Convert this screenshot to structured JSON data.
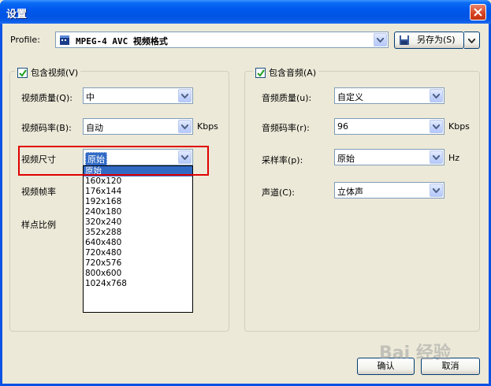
{
  "window": {
    "title": "设置"
  },
  "profile": {
    "label": "Profile:",
    "value": "MPEG-4 AVC 视频格式",
    "save_as_label": "另存为(S)"
  },
  "video": {
    "group_label": "包含视频(V)",
    "quality_label": "视频质量(Q):",
    "quality_value": "中",
    "bitrate_label": "视频码率(B):",
    "bitrate_value": "自动",
    "bitrate_unit": "Kbps",
    "size_label": "视频尺寸",
    "size_value": "原始",
    "framerate_label": "视频帧率",
    "aspect_label": "样点比例",
    "size_options": [
      "原始",
      "160x120",
      "176x144",
      "192x168",
      "240x180",
      "320x240",
      "352x288",
      "640x480",
      "720x480",
      "720x576",
      "800x600",
      "1024x768"
    ]
  },
  "audio": {
    "group_label": "包含音频(A)",
    "quality_label": "音频质量(u):",
    "quality_value": "自定义",
    "bitrate_label": "音频码率(r):",
    "bitrate_value": "96",
    "bitrate_unit": "Kbps",
    "samplerate_label": "采样率(p):",
    "samplerate_value": "原始",
    "samplerate_unit": "Hz",
    "channels_label": "声道(C):",
    "channels_value": "立体声"
  },
  "buttons": {
    "ok": "确认",
    "cancel": "取消"
  },
  "watermark": "Bai 经验",
  "colors": {
    "titlebar": "#0054e3",
    "highlight": "#e00000",
    "selection": "#316ac5"
  }
}
